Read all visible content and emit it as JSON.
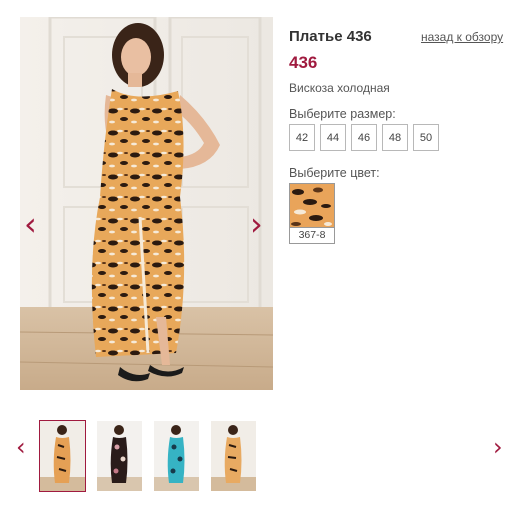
{
  "product": {
    "title": "Платье 436",
    "price": "436",
    "material": "Вискоза холодная",
    "back_link": "назад к обзору"
  },
  "sizes": {
    "label": "Выберите размер:",
    "options": [
      "42",
      "44",
      "46",
      "48",
      "50"
    ]
  },
  "colors": {
    "label": "Выберите цвет:",
    "options": [
      {
        "code": "367-8",
        "pattern": "leopard-print"
      }
    ]
  },
  "gallery": {
    "prev_icon": "‹",
    "next_icon": "›",
    "thumbnails": [
      {
        "pattern": "leopard-print",
        "active": true
      },
      {
        "pattern": "dark-floral",
        "active": false
      },
      {
        "pattern": "turquoise-print",
        "active": false
      },
      {
        "pattern": "leopard-print",
        "active": false
      }
    ]
  },
  "colors_palette": {
    "accent": "#a01a3f",
    "text": "#444444",
    "border": "#b8b8b8"
  }
}
